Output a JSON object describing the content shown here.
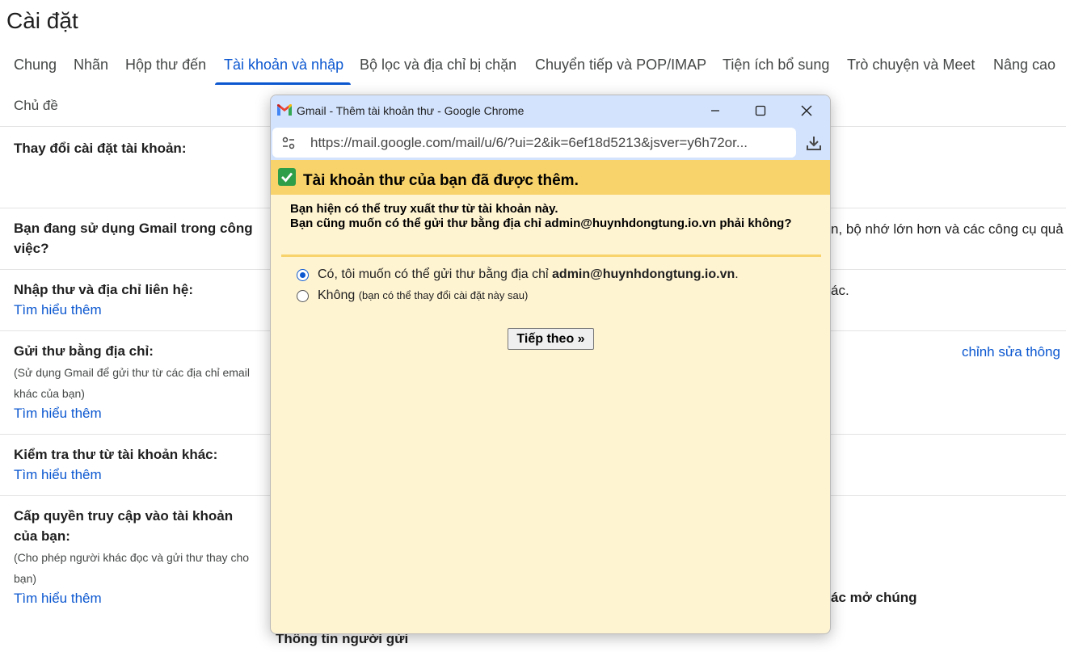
{
  "page": {
    "title": "Cài đặt",
    "tabs": [
      "Chung",
      "Nhãn",
      "Hộp thư đến",
      "Tài khoản và nhập",
      "Bộ lọc và địa chỉ bị chặn",
      "Chuyển tiếp và POP/IMAP",
      "Tiện ích bổ sung",
      "Trò chuyện và Meet",
      "Nâng cao",
      "Chủ đề"
    ],
    "active_tab": "Tài khoản và nhập"
  },
  "rows": {
    "change_settings": "Thay đổi cài đặt tài khoản:",
    "workspace": {
      "label": "Bạn đang sử dụng Gmail trong công việc?",
      "right_text": "n, bộ nhớ lớn hơn và các công cụ quả"
    },
    "import": {
      "label": "Nhập thư và địa chỉ liên hệ:",
      "learn": "Tìm hiểu thêm",
      "right_text": "ác."
    },
    "send_as": {
      "label": "Gửi thư bằng địa chỉ:",
      "sub": "(Sử dụng Gmail để gửi thư từ các địa chỉ email khác của bạn)",
      "learn": "Tìm hiểu thêm",
      "right_link": "chỉnh sửa thông"
    },
    "check_mail": {
      "label": "Kiểm tra thư từ tài khoản khác:",
      "learn": "Tìm hiểu thêm"
    },
    "grant_access": {
      "label": "Cấp quyền truy cập vào tài khoản của bạn:",
      "sub": "(Cho phép người khác đọc và gửi thư thay cho bạn)",
      "learn": "Tìm hiểu thêm",
      "right_text": "ác mở chúng"
    },
    "sender_info": "Thông tin người gửi"
  },
  "popup": {
    "window_title": "Gmail - Thêm tài khoản thư - Google Chrome",
    "url": "https://mail.google.com/mail/u/6/?ui=2&ik=6ef18d5213&jsver=y6h72or...",
    "banner_title": "Tài khoản thư của bạn đã được thêm.",
    "message_line1": "Bạn hiện có thể truy xuất thư từ tài khoản này.",
    "message_line2": "Bạn cũng muốn có thể gửi thư bằng địa chỉ admin@huynhdongtung.io.vn phải không?",
    "option_yes_prefix": "Có, tôi muốn có thể gửi thư bằng địa chỉ ",
    "option_yes_email": "admin@huynhdongtung.io.vn",
    "option_yes_suffix": ".",
    "option_no": "Không",
    "option_no_note": "(bạn có thể thay đổi cài đặt này sau)",
    "selected_option": "yes",
    "next_button": "Tiếp theo »"
  },
  "colors": {
    "accent": "#0b57d0",
    "banner": "#f8d36b",
    "dialog_bg": "#fff4d2",
    "titlebar": "#d3e3fd"
  }
}
